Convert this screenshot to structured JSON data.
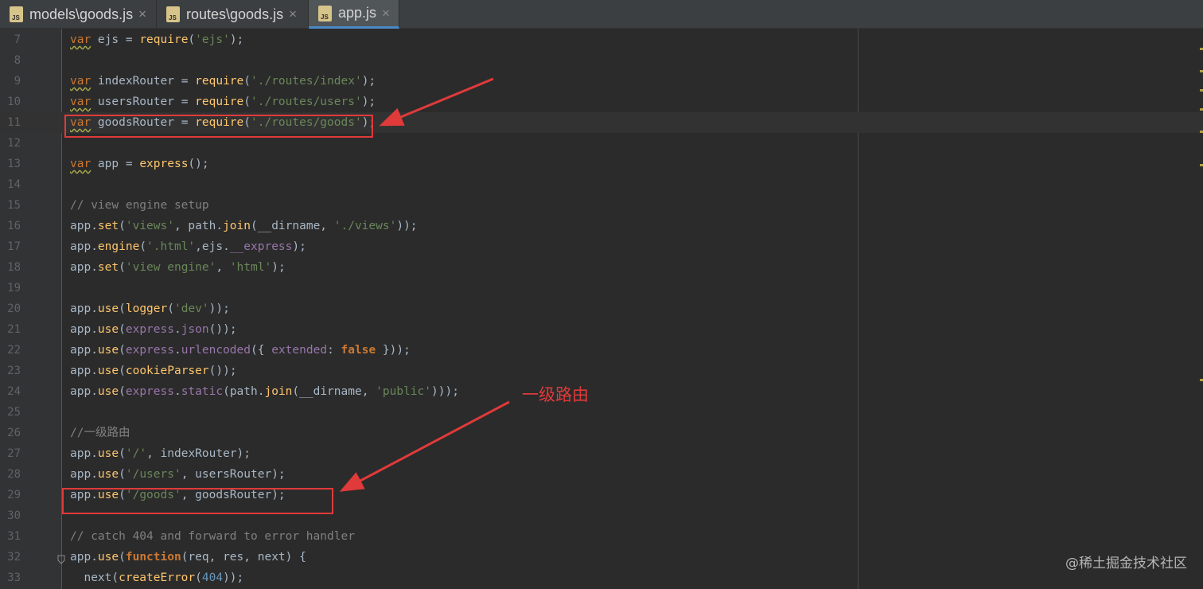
{
  "tabs": [
    {
      "label": "models\\goods.js",
      "close": "×"
    },
    {
      "label": "routes\\goods.js",
      "close": "×"
    },
    {
      "label": "app.js",
      "close": "×"
    }
  ],
  "lines": [
    {
      "n": "7",
      "tokens": [
        [
          "var",
          "kw uw"
        ],
        [
          " ejs = ",
          ""
        ],
        [
          "require",
          "fn"
        ],
        [
          "(",
          ""
        ],
        [
          "'ejs'",
          "str"
        ],
        [
          ");",
          ""
        ]
      ]
    },
    {
      "n": "8",
      "tokens": []
    },
    {
      "n": "9",
      "tokens": [
        [
          "var",
          "kw uw"
        ],
        [
          " indexRouter = ",
          ""
        ],
        [
          "require",
          "fn"
        ],
        [
          "(",
          ""
        ],
        [
          "'./routes/index'",
          "str"
        ],
        [
          ");",
          ""
        ]
      ]
    },
    {
      "n": "10",
      "tokens": [
        [
          "var",
          "kw uw"
        ],
        [
          " usersRouter = ",
          ""
        ],
        [
          "require",
          "fn"
        ],
        [
          "(",
          ""
        ],
        [
          "'./routes/users'",
          "str"
        ],
        [
          ");",
          ""
        ]
      ]
    },
    {
      "n": "11",
      "current": true,
      "tokens": [
        [
          "var",
          "kw uw"
        ],
        [
          " goodsRouter = ",
          ""
        ],
        [
          "require",
          "fn"
        ],
        [
          "(",
          ""
        ],
        [
          "'./routes/goods'",
          "str"
        ],
        [
          ");",
          ""
        ]
      ]
    },
    {
      "n": "12",
      "tokens": []
    },
    {
      "n": "13",
      "tokens": [
        [
          "var",
          "kw uw"
        ],
        [
          " app = ",
          ""
        ],
        [
          "express",
          "fn"
        ],
        [
          "();",
          ""
        ]
      ]
    },
    {
      "n": "14",
      "tokens": []
    },
    {
      "n": "15",
      "tokens": [
        [
          "// view engine setup",
          "cmt"
        ]
      ]
    },
    {
      "n": "16",
      "tokens": [
        [
          "app.",
          ""
        ],
        [
          "set",
          "fn"
        ],
        [
          "(",
          ""
        ],
        [
          "'views'",
          "str"
        ],
        [
          ", path.",
          ""
        ],
        [
          "join",
          "fn"
        ],
        [
          "(__dirname, ",
          ""
        ],
        [
          "'./views'",
          "str"
        ],
        [
          "));",
          ""
        ]
      ]
    },
    {
      "n": "17",
      "tokens": [
        [
          "app.",
          ""
        ],
        [
          "engine",
          "fn"
        ],
        [
          "(",
          ""
        ],
        [
          "'.html'",
          "str"
        ],
        [
          ",ejs.",
          ""
        ],
        [
          "__express",
          "prop"
        ],
        [
          ");",
          ""
        ]
      ]
    },
    {
      "n": "18",
      "tokens": [
        [
          "app.",
          ""
        ],
        [
          "set",
          "fn"
        ],
        [
          "(",
          ""
        ],
        [
          "'view engine'",
          "str"
        ],
        [
          ", ",
          ""
        ],
        [
          "'html'",
          "str"
        ],
        [
          ");",
          ""
        ]
      ]
    },
    {
      "n": "19",
      "tokens": []
    },
    {
      "n": "20",
      "tokens": [
        [
          "app.",
          ""
        ],
        [
          "use",
          "fn"
        ],
        [
          "(",
          ""
        ],
        [
          "logger",
          "fn"
        ],
        [
          "(",
          ""
        ],
        [
          "'dev'",
          "str"
        ],
        [
          "));",
          ""
        ]
      ]
    },
    {
      "n": "21",
      "tokens": [
        [
          "app.",
          ""
        ],
        [
          "use",
          "fn"
        ],
        [
          "(",
          ""
        ],
        [
          "express",
          "prop"
        ],
        [
          ".",
          ""
        ],
        [
          "json",
          "prop"
        ],
        [
          "());",
          ""
        ]
      ]
    },
    {
      "n": "22",
      "tokens": [
        [
          "app.",
          ""
        ],
        [
          "use",
          "fn"
        ],
        [
          "(",
          ""
        ],
        [
          "express",
          "prop"
        ],
        [
          ".",
          ""
        ],
        [
          "urlencoded",
          "prop"
        ],
        [
          "({ ",
          ""
        ],
        [
          "extended",
          "prop"
        ],
        [
          ": ",
          ""
        ],
        [
          "false",
          "kw b"
        ],
        [
          " }));",
          ""
        ]
      ]
    },
    {
      "n": "23",
      "tokens": [
        [
          "app.",
          ""
        ],
        [
          "use",
          "fn"
        ],
        [
          "(",
          ""
        ],
        [
          "cookieParser",
          "fn"
        ],
        [
          "());",
          ""
        ]
      ]
    },
    {
      "n": "24",
      "tokens": [
        [
          "app.",
          ""
        ],
        [
          "use",
          "fn"
        ],
        [
          "(",
          ""
        ],
        [
          "express",
          "prop"
        ],
        [
          ".",
          ""
        ],
        [
          "static",
          "prop"
        ],
        [
          "(path.",
          ""
        ],
        [
          "join",
          "fn"
        ],
        [
          "(__dirname, ",
          ""
        ],
        [
          "'public'",
          "str"
        ],
        [
          ")));",
          ""
        ]
      ]
    },
    {
      "n": "25",
      "tokens": []
    },
    {
      "n": "26",
      "tokens": [
        [
          "//一级路由",
          "cmt"
        ]
      ]
    },
    {
      "n": "27",
      "tokens": [
        [
          "app.",
          ""
        ],
        [
          "use",
          "fn"
        ],
        [
          "(",
          ""
        ],
        [
          "'/'",
          "str"
        ],
        [
          ", indexRouter);",
          ""
        ]
      ]
    },
    {
      "n": "28",
      "tokens": [
        [
          "app.",
          ""
        ],
        [
          "use",
          "fn"
        ],
        [
          "(",
          ""
        ],
        [
          "'/users'",
          "str"
        ],
        [
          ", usersRouter);",
          ""
        ]
      ]
    },
    {
      "n": "29",
      "tokens": [
        [
          "app.",
          ""
        ],
        [
          "use",
          "fn"
        ],
        [
          "(",
          ""
        ],
        [
          "'/goods'",
          "str"
        ],
        [
          ", goodsRouter);",
          ""
        ]
      ]
    },
    {
      "n": "30",
      "tokens": []
    },
    {
      "n": "31",
      "tokens": [
        [
          "// catch 404 and forward to error handler",
          "cmt"
        ]
      ]
    },
    {
      "n": "32",
      "tokens": [
        [
          "app.",
          ""
        ],
        [
          "use",
          "fn"
        ],
        [
          "(",
          ""
        ],
        [
          "function",
          "kw b"
        ],
        [
          "(req, res, next) {",
          ""
        ]
      ]
    },
    {
      "n": "33",
      "tokens": [
        [
          "  next(",
          ""
        ],
        [
          "createError",
          "fn"
        ],
        [
          "(",
          ""
        ],
        [
          "404",
          "num"
        ],
        [
          "));",
          ""
        ]
      ]
    }
  ],
  "annotation": "一级路由",
  "watermark": "@稀土掘金技术社区",
  "colors": {
    "highlight": "#e03a3a",
    "background": "#2b2b2b"
  }
}
